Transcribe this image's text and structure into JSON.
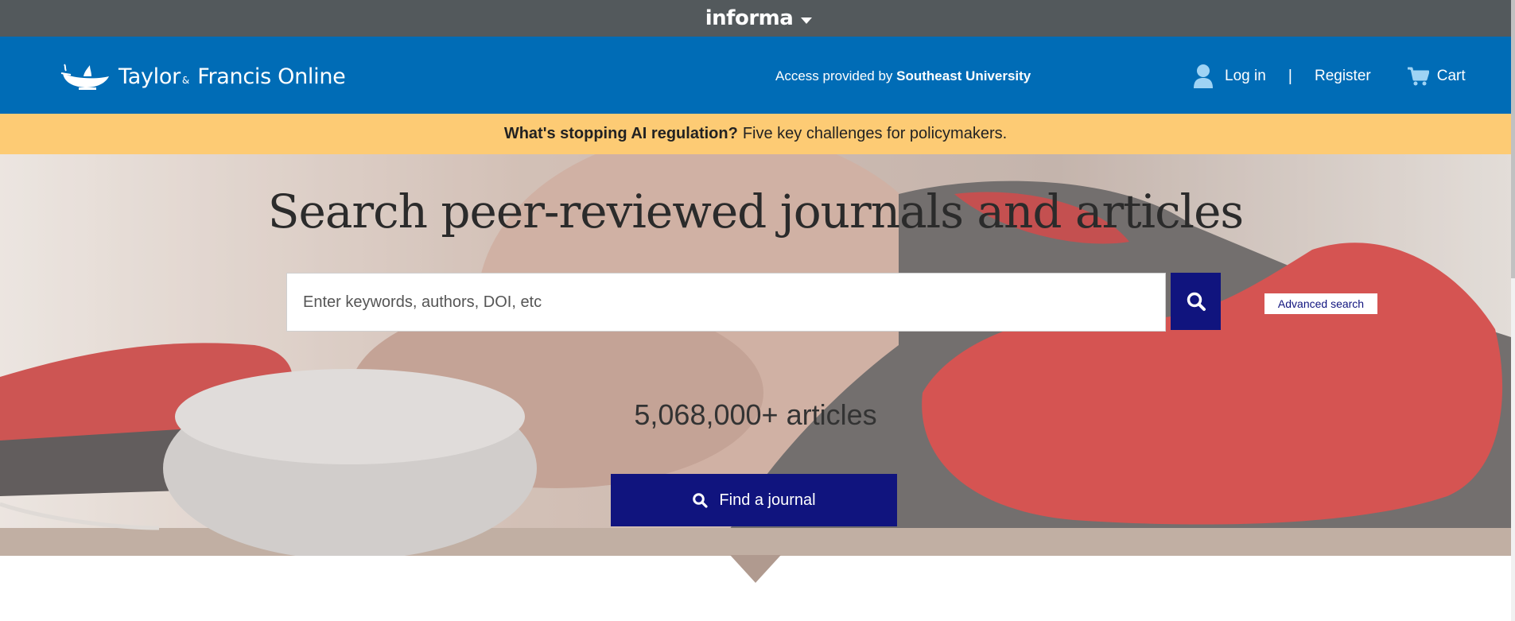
{
  "informa": {
    "label": "informa"
  },
  "header": {
    "brand": {
      "part1": "Taylor",
      "amp": "&",
      "part2": "Francis Online"
    },
    "access_prefix": "Access provided by",
    "access_institution": "Southeast University",
    "login_label": "Log in",
    "separator": "|",
    "register_label": "Register",
    "cart_label": "Cart"
  },
  "alert": {
    "bold": "What's stopping AI regulation?",
    "text": "Five key challenges for policymakers."
  },
  "hero": {
    "title": "Search peer-reviewed journals and articles",
    "search_placeholder": "Enter keywords, authors, DOI, etc",
    "advanced_search_label": "Advanced search",
    "article_count": "5,068,000+ articles",
    "find_journal_label": "Find a journal"
  },
  "colors": {
    "informa_bar": "#53595c",
    "header_blue": "#006cb6",
    "alert_yellow": "#fdcb74",
    "button_navy": "#10147e"
  },
  "icons": [
    "informa-caret-icon",
    "taylor-francis-lamp-icon",
    "user-icon",
    "cart-icon",
    "search-icon"
  ]
}
